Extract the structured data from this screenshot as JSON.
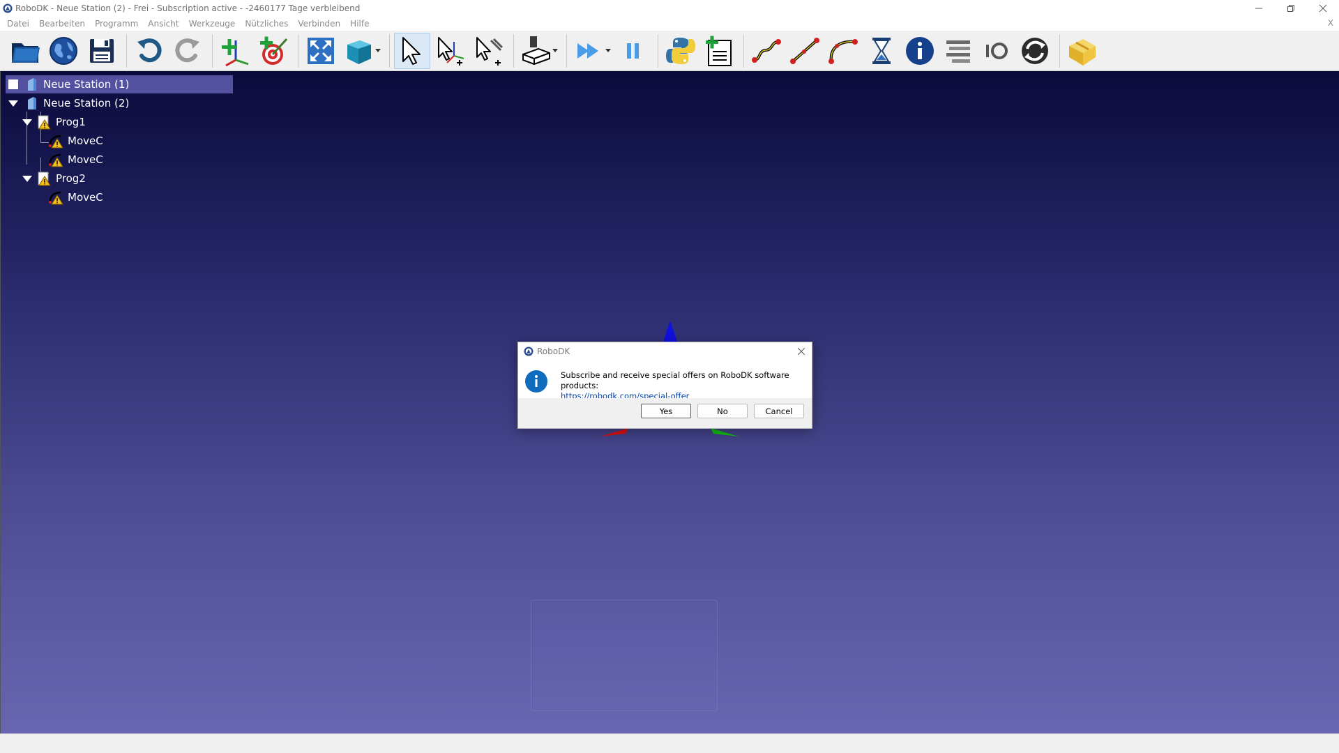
{
  "window": {
    "title": "RoboDK - Neue Station (2) - Frei - Subscription active - -2460177 Tage verbleibend"
  },
  "menu": {
    "items": [
      "Datei",
      "Bearbeiten",
      "Programm",
      "Ansicht",
      "Werkzeuge",
      "Nützliches",
      "Verbinden",
      "Hilfe"
    ],
    "close_label": "X"
  },
  "toolbar": {
    "icons": [
      "open-folder-icon",
      "globe-icon",
      "save-icon",
      "undo-icon",
      "redo-icon",
      "add-reference-frame-icon",
      "add-target-icon",
      "fit-all-icon",
      "view-cube-icon",
      "select-arrow-icon",
      "move-reference-icon",
      "move-tool-icon",
      "machining-icon",
      "run-program-icon",
      "pause-icon",
      "python-icon",
      "add-program-icon",
      "joint-move-icon",
      "linear-move-icon",
      "circular-move-icon",
      "pause-hourglass-icon",
      "info-icon",
      "set-tool-icon",
      "io-icon",
      "call-program-icon",
      "package-icon"
    ]
  },
  "tree": {
    "items": [
      {
        "label": "Neue Station (1)",
        "type": "station",
        "level": 0,
        "selected": true
      },
      {
        "label": "Neue Station (2)",
        "type": "station",
        "level": 0,
        "expanded": true
      },
      {
        "label": "Prog1",
        "type": "program",
        "level": 1,
        "expanded": true
      },
      {
        "label": "MoveC",
        "type": "instruction",
        "level": 2
      },
      {
        "label": "MoveC",
        "type": "instruction",
        "level": 2
      },
      {
        "label": "Prog2",
        "type": "program",
        "level": 1,
        "expanded": true
      },
      {
        "label": "MoveC",
        "type": "instruction",
        "level": 2
      }
    ]
  },
  "dialog": {
    "title": "RoboDK",
    "message": "Subscribe and receive special offers on RoboDK software products:",
    "link": "https://robodk.com/special-offer",
    "buttons": {
      "yes": "Yes",
      "no": "No",
      "cancel": "Cancel"
    }
  },
  "colors": {
    "viewport_top": "#0a0a3c",
    "viewport_bottom": "#6866b0",
    "selection": "#5351a0",
    "link": "#0645ad",
    "info_blue": "#0f6cbd"
  }
}
